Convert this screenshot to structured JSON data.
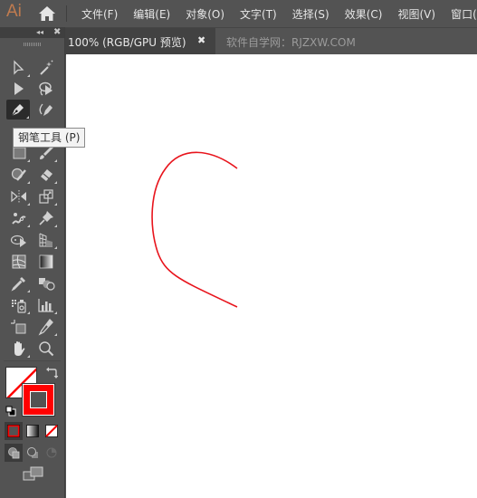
{
  "app": {
    "logo": "Ai",
    "menu": [
      {
        "label": "文件(F)"
      },
      {
        "label": "编辑(E)"
      },
      {
        "label": "对象(O)"
      },
      {
        "label": "文字(T)"
      },
      {
        "label": "选择(S)"
      },
      {
        "label": "效果(C)"
      },
      {
        "label": "视图(V)"
      },
      {
        "label": "窗口(W)"
      }
    ]
  },
  "toolbox": {
    "collapse_glyph": "◂◂",
    "close_glyph": "✖",
    "tools": [
      {
        "name": "direct-selection-tool"
      },
      {
        "name": "magic-wand-tool"
      },
      {
        "name": "selection-tool"
      },
      {
        "name": "lasso-tool"
      },
      {
        "name": "pen-tool",
        "active": true
      },
      {
        "name": "curvature-tool"
      },
      {
        "name": "rectangle-tool"
      },
      {
        "name": "paintbrush-tool"
      },
      {
        "name": "shaper-tool"
      },
      {
        "name": "eraser-tool"
      },
      {
        "name": "reflect-tool"
      },
      {
        "name": "scale-tool"
      },
      {
        "name": "puppet-warp-tool"
      },
      {
        "name": "pin-tool"
      },
      {
        "name": "shape-builder-tool"
      },
      {
        "name": "perspective-grid-tool"
      },
      {
        "name": "mesh-tool"
      },
      {
        "name": "gradient-tool"
      },
      {
        "name": "eyedropper-tool"
      },
      {
        "name": "blend-tool"
      },
      {
        "name": "symbol-sprayer-tool"
      },
      {
        "name": "column-graph-tool"
      },
      {
        "name": "artboard-tool"
      },
      {
        "name": "slice-tool"
      },
      {
        "name": "hand-tool"
      },
      {
        "name": "zoom-tool"
      }
    ],
    "tooltip": "钢笔工具 (P)",
    "fill_color": "none",
    "stroke_color": "#ff0000"
  },
  "tabs": {
    "active_label": "100% (RGB/GPU 预览)",
    "close_glyph": "✖",
    "inactive_label": "软件自学网：RJZXW.COM"
  },
  "canvas": {
    "path_stroke": "#e8141c"
  }
}
